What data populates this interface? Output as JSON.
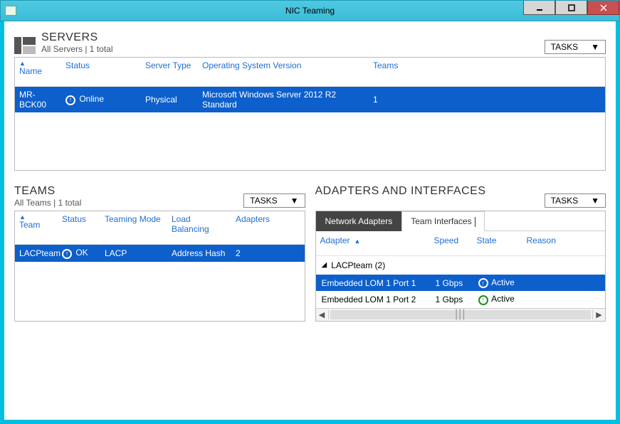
{
  "window": {
    "title": "NIC Teaming"
  },
  "tasks_label": "TASKS",
  "servers": {
    "title": "SERVERS",
    "subtitle": "All Servers | 1 total",
    "columns": {
      "name": "Name",
      "status": "Status",
      "type": "Server Type",
      "os": "Operating System Version",
      "teams": "Teams"
    },
    "rows": [
      {
        "name": "MR-BCK00",
        "status": "Online",
        "type": "Physical",
        "os": "Microsoft Windows Server 2012 R2 Standard",
        "teams": "1"
      }
    ]
  },
  "teams": {
    "title": "TEAMS",
    "subtitle": "All Teams | 1 total",
    "columns": {
      "team": "Team",
      "status": "Status",
      "mode": "Teaming Mode",
      "lb": "Load Balancing",
      "adapters": "Adapters"
    },
    "rows": [
      {
        "team": "LACPteam",
        "status": "OK",
        "mode": "LACP",
        "lb": "Address Hash",
        "adapters": "2"
      }
    ]
  },
  "adapters": {
    "title": "ADAPTERS AND INTERFACES",
    "tabs": {
      "net": "Network Adapters",
      "team": "Team Interfaces"
    },
    "columns": {
      "adapter": "Adapter",
      "speed": "Speed",
      "state": "State",
      "reason": "Reason"
    },
    "group": "LACPteam (2)",
    "rows": [
      {
        "adapter": "Embedded LOM 1 Port 1",
        "speed": "1 Gbps",
        "state": "Active",
        "reason": ""
      },
      {
        "adapter": "Embedded LOM 1 Port 2",
        "speed": "1 Gbps",
        "state": "Active",
        "reason": ""
      }
    ]
  }
}
